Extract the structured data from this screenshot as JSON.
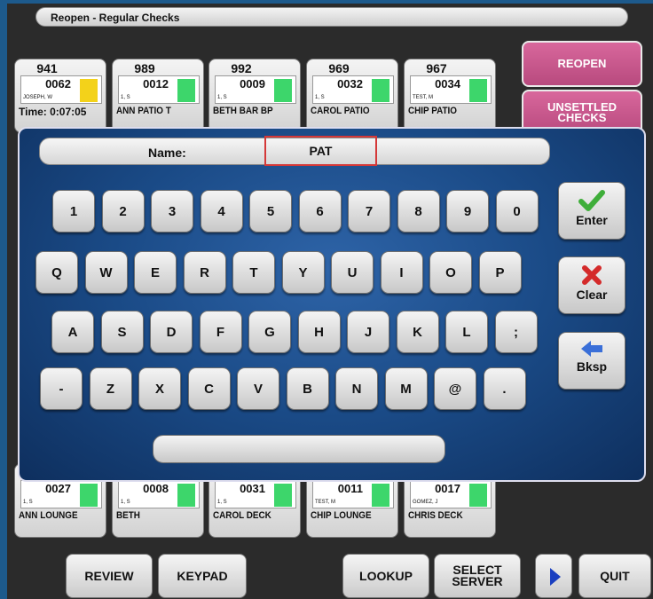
{
  "window": {
    "title": "Reopen - Regular Checks"
  },
  "colors": {
    "side_button": "#c45a8c",
    "status_green": "#3dd66b",
    "status_yellow": "#f3d21a",
    "highlight_red": "#d43838"
  },
  "checks_top": [
    {
      "number": "941",
      "amount": "0062",
      "server": "JOSEPH, W",
      "label": "Time:  0:07:05",
      "status": "yellow"
    },
    {
      "number": "989",
      "amount": "0012",
      "server": "1, S",
      "label": "ANN PATIO T",
      "status": "green"
    },
    {
      "number": "992",
      "amount": "0009",
      "server": "1, S",
      "label": "BETH BAR BP",
      "status": "green"
    },
    {
      "number": "969",
      "amount": "0032",
      "server": "1, S",
      "label": "CAROL PATIO",
      "status": "green"
    },
    {
      "number": "967",
      "amount": "0034",
      "server": "TEST, M",
      "label": "CHIP PATIO",
      "status": "green"
    }
  ],
  "checks_bottom": [
    {
      "amount": "0027",
      "server": "1, S",
      "label": "ANN LOUNGE",
      "status": "green"
    },
    {
      "amount": "0008",
      "server": "1, S",
      "label": "BETH",
      "status": "green"
    },
    {
      "amount": "0031",
      "server": "1, S",
      "label": "CAROL DECK",
      "status": "green"
    },
    {
      "amount": "0011",
      "server": "TEST, M",
      "label": "CHIP LOUNGE",
      "status": "green"
    },
    {
      "amount": "0017",
      "server": "GOMEZ, J",
      "label": "CHRIS DECK",
      "status": "green"
    }
  ],
  "side_buttons": {
    "reopen": "REOPEN",
    "unsettled_line1": "UNSETTLED",
    "unsettled_line2": "CHECKS"
  },
  "bottom_buttons": {
    "review": "REVIEW",
    "keypad": "KEYPAD",
    "lookup": "LOOKUP",
    "select_line1": "SELECT",
    "select_line2": "SERVER",
    "quit": "QUIT"
  },
  "name_field": {
    "label": "Name:",
    "value": "PAT"
  },
  "keyboard": {
    "rows": [
      [
        "1",
        "2",
        "3",
        "4",
        "5",
        "6",
        "7",
        "8",
        "9",
        "0"
      ],
      [
        "Q",
        "W",
        "E",
        "R",
        "T",
        "Y",
        "U",
        "I",
        "O",
        "P"
      ],
      [
        "A",
        "S",
        "D",
        "F",
        "G",
        "H",
        "J",
        "K",
        "L",
        ";"
      ],
      [
        "-",
        "Z",
        "X",
        "C",
        "V",
        "B",
        "N",
        "M",
        "@",
        "."
      ]
    ],
    "enter": "Enter",
    "clear": "Clear",
    "backspace": "Bksp"
  }
}
